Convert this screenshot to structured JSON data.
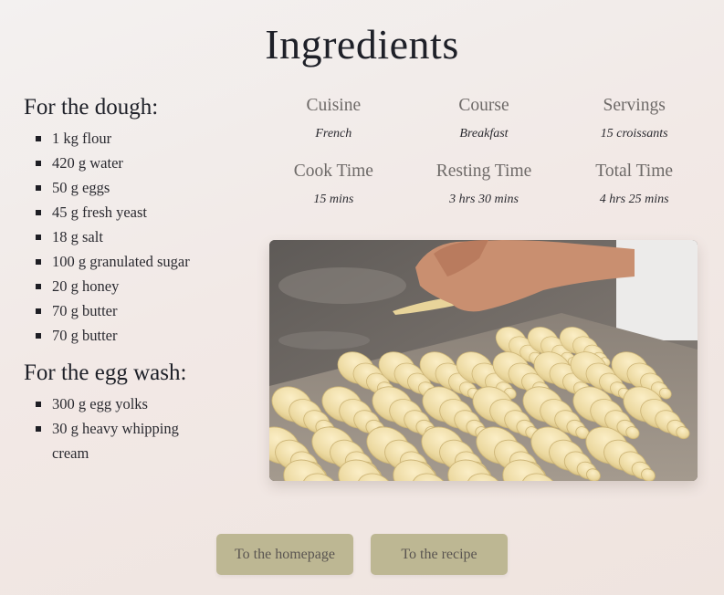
{
  "page": {
    "title": "Ingredients"
  },
  "ingredients": {
    "sections": [
      {
        "heading": "For the dough:",
        "items": [
          "1 kg flour",
          "420 g water",
          "50 g eggs",
          "45 g fresh yeast",
          "18 g salt",
          "100 g granulated sugar",
          "20 g honey",
          "70 g butter",
          "70 g butter"
        ]
      },
      {
        "heading": "For the egg wash:",
        "items": [
          "300 g egg yolks",
          "30 g heavy whipping cream"
        ]
      }
    ]
  },
  "info": [
    {
      "label": "Cuisine",
      "value": "French"
    },
    {
      "label": "Course",
      "value": "Breakfast"
    },
    {
      "label": "Servings",
      "value": "15 croissants"
    },
    {
      "label": "Cook Time",
      "value": "15 mins"
    },
    {
      "label": "Resting Time",
      "value": "3 hrs 30 mins"
    },
    {
      "label": "Total Time",
      "value": "4 hrs 25 mins"
    }
  ],
  "photo": {
    "alt": "Unbaked croissants on a baking tray with hands rolling dough"
  },
  "buttons": {
    "homepage": "To the homepage",
    "recipe": "To the recipe"
  },
  "colors": {
    "button_bg": "#bdb793",
    "button_text": "#5a5551",
    "label_gray": "#6e6a68"
  }
}
